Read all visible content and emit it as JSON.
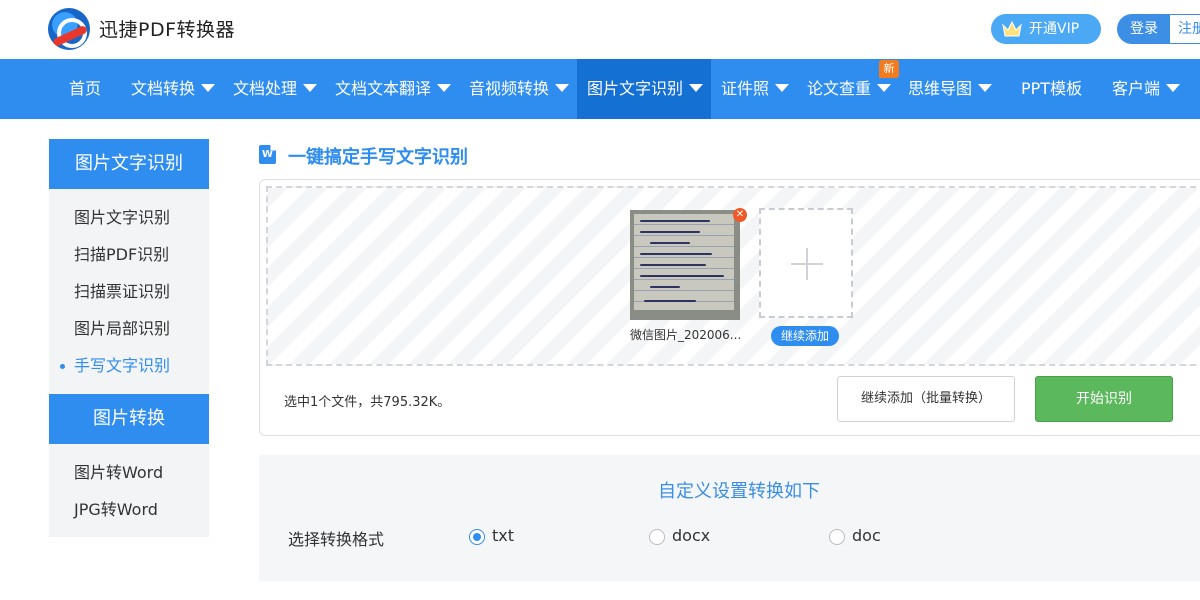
{
  "header": {
    "brand": "迅捷PDF转换器",
    "vip_label": "开通VIP",
    "login_label": "登录",
    "register_label": "注册"
  },
  "nav": {
    "items": [
      {
        "label": "首页"
      },
      {
        "label": "文档转换"
      },
      {
        "label": "文档处理"
      },
      {
        "label": "文档文本翻译"
      },
      {
        "label": "音视频转换"
      },
      {
        "label": "图片文字识别"
      },
      {
        "label": "证件照"
      },
      {
        "label": "论文查重"
      },
      {
        "label": "思维导图"
      },
      {
        "label": "PPT模板"
      },
      {
        "label": "客户端"
      }
    ],
    "active_index": 5,
    "new_badge": "新"
  },
  "sidebar": {
    "sections": [
      {
        "title": "图片文字识别",
        "items": [
          "图片文字识别",
          "扫描PDF识别",
          "扫描票证识别",
          "图片局部识别",
          "手写文字识别"
        ]
      },
      {
        "title": "图片转换",
        "items": [
          "图片转Word",
          "JPG转Word"
        ]
      }
    ],
    "active_item": "手写文字识别"
  },
  "main": {
    "title_icon": "W",
    "title": "一键搞定手写文字识别",
    "upload": {
      "file_name": "微信图片_202006...",
      "add_more": "继续添加",
      "file_info": "选中1个文件，共795.32K。",
      "batch_button": "继续添加（批量转换）",
      "start_button": "开始识别"
    },
    "settings": {
      "title": "自定义设置转换如下",
      "format_label": "选择转换格式",
      "formats": [
        {
          "label": "txt",
          "checked": true
        },
        {
          "label": "docx",
          "checked": false
        },
        {
          "label": "doc",
          "checked": false
        }
      ]
    }
  },
  "colors": {
    "primary": "#2f8df0",
    "nav_active": "#1570d4",
    "start_green": "#5cb85c",
    "badge_orange": "#f27b1f"
  },
  "icons": [
    "logo-icon",
    "crown-icon",
    "caret-down-icon",
    "word-doc-icon",
    "close-icon",
    "plus-icon",
    "radio-icon"
  ]
}
